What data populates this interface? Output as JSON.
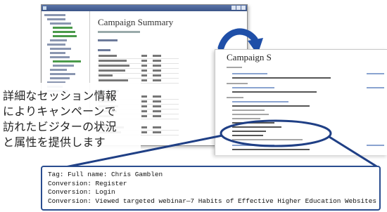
{
  "back_window": {
    "title": "Campaign Summary"
  },
  "front_window": {
    "title": "Campaign S"
  },
  "callout_jp": {
    "lines": [
      "詳細なセッション情報",
      "によりキャンペーンで",
      "訪れたビジターの状況",
      "と属性を提供します"
    ]
  },
  "info_box": {
    "lines": [
      "Tag: Full name: Chris Gamblen",
      "Conversion: Register",
      "Conversion: Login",
      "Conversion: Viewed targeted webinar—7 Habits of Effective Higher Education Websites"
    ]
  },
  "colors": {
    "highlight": "#1f3f85",
    "arrow": "#1f4fa8",
    "tree_green": "#4a9a4a"
  }
}
